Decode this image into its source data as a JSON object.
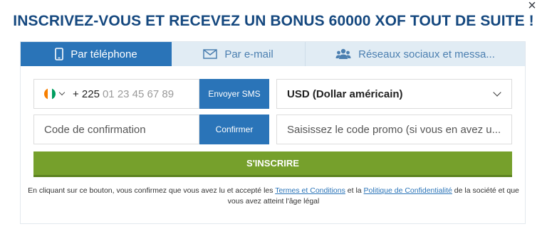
{
  "title": "INSCRIVEZ-VOUS ET RECEVEZ UN BONUS 60000 XOF TOUT DE SUITE !",
  "close_label": "×",
  "tabs": [
    {
      "label": "Par téléphone",
      "icon": "phone-icon",
      "active": true
    },
    {
      "label": "Par e-mail",
      "icon": "envelope-icon",
      "active": false
    },
    {
      "label": "Réseaux sociaux et messa...",
      "icon": "users-icon",
      "active": false
    }
  ],
  "phone": {
    "country_flag": "cote-divoire-flag",
    "prefix": "+ 225",
    "placeholder": "01 23 45 67 89",
    "sms_button": "Envoyer SMS"
  },
  "currency": {
    "selected": "USD (Dollar américain)"
  },
  "confirmation": {
    "placeholder": "Code de confirmation",
    "button": "Confirmer"
  },
  "promo": {
    "placeholder": "Saisissez le code promo (si vous en avez u..."
  },
  "register_button": "S'INSCRIRE",
  "legal": {
    "part1": "En cliquant sur ce bouton, vous confirmez que vous avez lu et accepté les ",
    "terms_link": "Termes et Conditions",
    "part2": " et la ",
    "privacy_link": "Politique de Confidentialité",
    "part3": " de la société et que vous avez atteint l'âge légal"
  },
  "colors": {
    "title": "#15487f",
    "tab_active": "#2a74b8",
    "tab_inactive_bg": "#e1ecf4",
    "register": "#76a02c",
    "flag": [
      "#f77f00",
      "#ffffff",
      "#009e60"
    ]
  }
}
